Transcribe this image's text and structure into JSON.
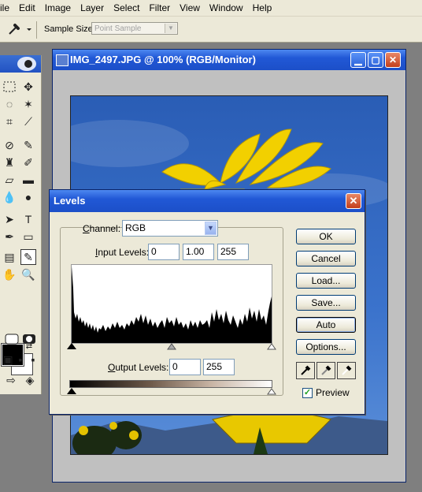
{
  "menubar": {
    "items": [
      "ile",
      "Edit",
      "Image",
      "Layer",
      "Select",
      "Filter",
      "View",
      "Window",
      "Help"
    ]
  },
  "options_bar": {
    "sample_size_label": "Sample Size:",
    "sample_size_value": "Point Sample"
  },
  "document": {
    "title": "IMG_2497.JPG @ 100% (RGB/Monitor)",
    "min_glyph": "▁",
    "max_glyph": "▢",
    "close_glyph": "✕"
  },
  "levels": {
    "title": "Levels",
    "close_glyph": "✕",
    "channel_label_rest": "hannel:",
    "channel_label_key": "C",
    "channel_value": "RGB",
    "input_label_key": "I",
    "input_label_rest": "nput Levels:",
    "input_black": "0",
    "input_gamma": "1.00",
    "input_white": "255",
    "output_label_key": "O",
    "output_label_rest": "utput Levels:",
    "output_black": "0",
    "output_white": "255",
    "buttons": {
      "ok": "OK",
      "cancel": "Cancel",
      "load": "Load...",
      "save": "Save...",
      "auto": "Auto",
      "options": "Options..."
    },
    "preview_label": "Preview",
    "preview_checked": true
  },
  "colors": {
    "title_blue": "#2158d6",
    "close_red": "#c43f1c",
    "sky": "#2b5fb9",
    "sunflower": "#f2d000"
  }
}
